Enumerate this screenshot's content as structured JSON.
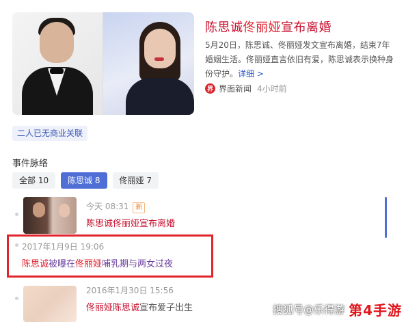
{
  "news": {
    "title_name1": "陈思诚",
    "title_name2": "佟丽娅",
    "title_rest": "宣布离婚",
    "summary": "5月20日，陈思诚、佟丽娅发文宣布离婚，结束7年婚姻生活。佟丽娅直言依旧有爱，陈思诚表示换种身份守护。",
    "more_link": "详细 >",
    "source_logo": "界",
    "source_name": "界面新闻",
    "source_time": "4小时前"
  },
  "tag": "二人已无商业关联",
  "section_title": "事件脉络",
  "filters": [
    {
      "label": "全部 10",
      "active": false
    },
    {
      "label": "陈思诚 8",
      "active": true
    },
    {
      "label": "佟丽娅 7",
      "active": false
    }
  ],
  "events": [
    {
      "time": "今天 08:31",
      "badge": "新",
      "title": "陈思诚佟丽娅宣布离婚"
    },
    {
      "time": "2017年1月9日 19:06",
      "title_p1": "陈思诚",
      "title_p2": "被曝在",
      "title_p3": "佟丽娅",
      "title_p4": "哺乳期与两女过夜"
    },
    {
      "time": "2016年1月30日 15:56",
      "title_p1": "佟丽娅",
      "title_p2": "陈思诚",
      "title_p3": "宣布爱子出生"
    }
  ],
  "watermark": {
    "text": "搜狐号@乐得游",
    "logo": "第4手游"
  },
  "colors": {
    "accent": "#4f6fd6",
    "headline_red": "#c8102e",
    "highlight_box": "#e1232b"
  }
}
